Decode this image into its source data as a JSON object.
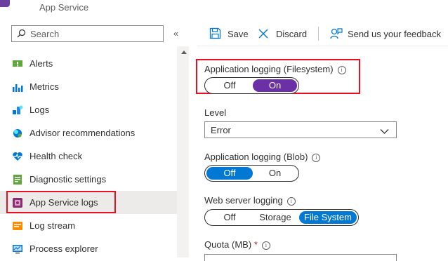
{
  "header": {
    "subtitle": "App Service"
  },
  "sidebar": {
    "search_placeholder": "Search",
    "collapse_glyph": "«",
    "items": [
      {
        "label": "Alerts",
        "icon": "alerts-icon"
      },
      {
        "label": "Metrics",
        "icon": "metrics-icon"
      },
      {
        "label": "Logs",
        "icon": "logs-icon"
      },
      {
        "label": "Advisor recommendations",
        "icon": "advisor-icon"
      },
      {
        "label": "Health check",
        "icon": "health-check-icon"
      },
      {
        "label": "Diagnostic settings",
        "icon": "diagnostic-settings-icon"
      },
      {
        "label": "App Service logs",
        "icon": "app-service-logs-icon",
        "selected": true
      },
      {
        "label": "Log stream",
        "icon": "log-stream-icon"
      },
      {
        "label": "Process explorer",
        "icon": "process-explorer-icon"
      }
    ]
  },
  "toolbar": {
    "save_label": "Save",
    "discard_label": "Discard",
    "feedback_label": "Send us your feedback"
  },
  "form": {
    "app_logging_fs": {
      "label": "Application logging (Filesystem)",
      "options": [
        "Off",
        "On"
      ],
      "selected": "On"
    },
    "level": {
      "label": "Level",
      "value": "Error"
    },
    "app_logging_blob": {
      "label": "Application logging (Blob)",
      "options": [
        "Off",
        "On"
      ],
      "selected": "Off"
    },
    "web_server_logging": {
      "label": "Web server logging",
      "options": [
        "Off",
        "Storage",
        "File System"
      ],
      "selected": "File System"
    },
    "quota": {
      "label": "Quota (MB)",
      "required_mark": "*"
    }
  },
  "colors": {
    "accent": "#0078d4",
    "selected_toggle": "#6b2fa6",
    "highlight": "#e81123"
  }
}
